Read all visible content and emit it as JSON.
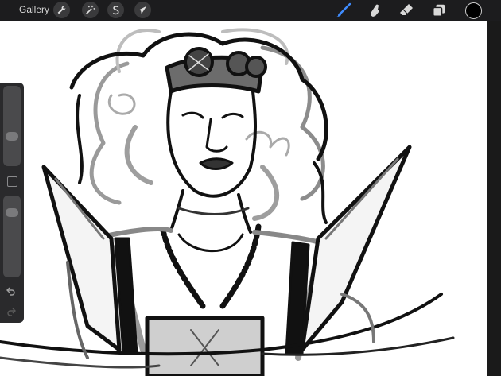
{
  "toolbar": {
    "gallery_label": "Gallery",
    "left_tools": [
      {
        "name": "actions",
        "icon": "wrench-icon"
      },
      {
        "name": "adjustments",
        "icon": "magic-wand-icon"
      },
      {
        "name": "selection",
        "icon": "selection-s-icon"
      },
      {
        "name": "transform",
        "icon": "arrow-cursor-icon"
      }
    ],
    "right_tools": [
      {
        "name": "brush",
        "icon": "brush-icon",
        "active": true
      },
      {
        "name": "smudge",
        "icon": "smudge-icon"
      },
      {
        "name": "eraser",
        "icon": "eraser-icon"
      },
      {
        "name": "layers",
        "icon": "layers-icon"
      }
    ],
    "current_color": "#000000",
    "active_tool_color": "#3f8cff"
  },
  "sidebar": {
    "brush_size_level": 0.35,
    "opacity_level": 0.85
  }
}
